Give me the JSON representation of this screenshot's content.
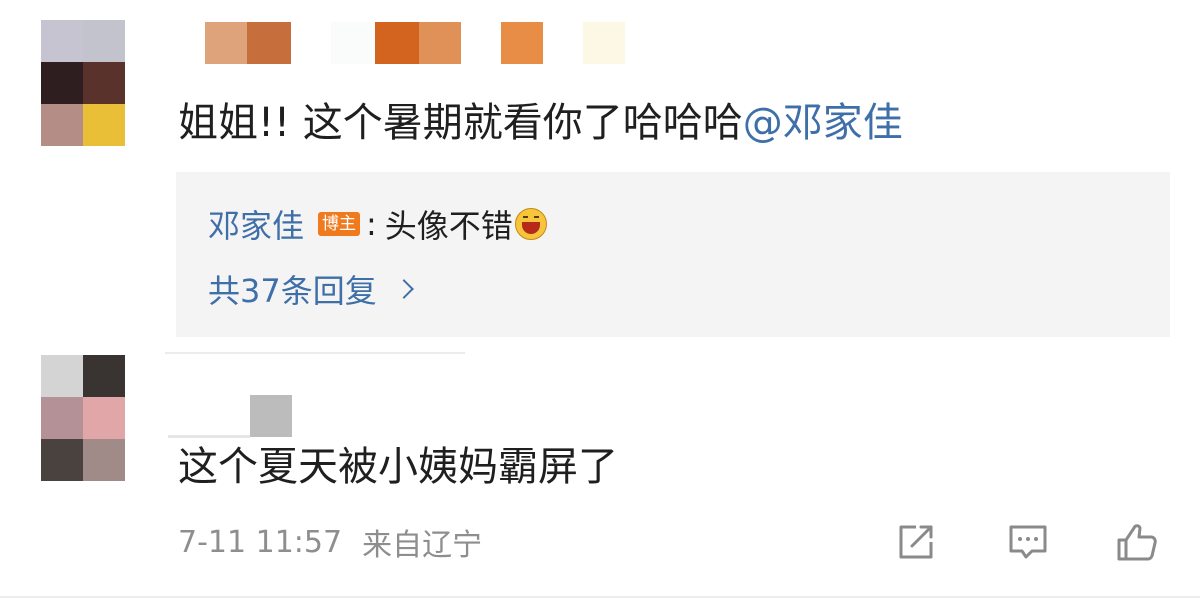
{
  "comment1": {
    "text": "姐姐!! 这个暑期就看你了哈哈哈",
    "mention": "@邓家佳",
    "reply": {
      "author": "邓家佳",
      "badge": "博主",
      "separator": ":",
      "text": "头像不错",
      "emoji": "laugh-emoji"
    },
    "reply_count_label": "共37条回复"
  },
  "comment2": {
    "text": "这个夏天被小姨妈霸屏了",
    "time": "7-11 11:57",
    "source": "来自辽宁"
  },
  "actions": {
    "share_icon": "share-icon",
    "comment_icon": "comment-icon",
    "like_icon": "thumbs-up-icon"
  },
  "colors": {
    "link": "#3f6fa8",
    "badge": "#f07a1e",
    "reply_bg": "#f4f4f4",
    "meta": "#8e8e8e"
  }
}
